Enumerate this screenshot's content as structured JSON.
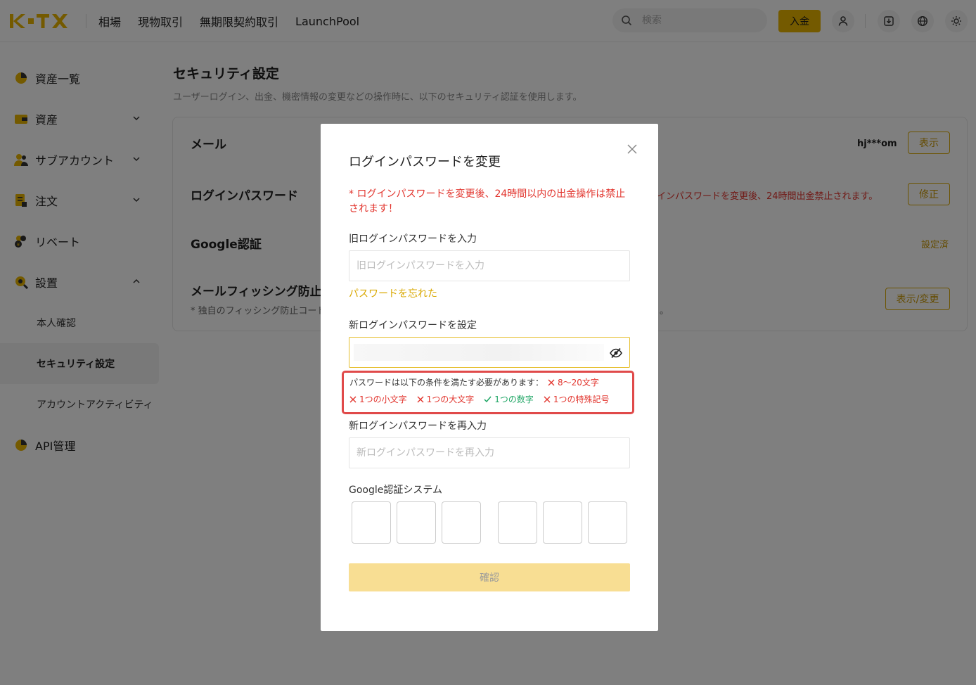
{
  "brand": {
    "logo_text": "KTX",
    "accent": "#e9b400"
  },
  "nav": {
    "items": [
      "相場",
      "現物取引",
      "無期限契約取引",
      "LaunchPool"
    ],
    "search_placeholder": "検索",
    "deposit_label": "入金"
  },
  "sidebar": {
    "items": [
      {
        "label": "資産一覧",
        "icon": "pie-chart-icon"
      },
      {
        "label": "資産",
        "icon": "wallet-icon"
      },
      {
        "label": "サブアカウント",
        "icon": "users-icon"
      },
      {
        "label": "注文",
        "icon": "document-icon"
      },
      {
        "label": "リベート",
        "icon": "rebate-icon"
      },
      {
        "label": "設置",
        "icon": "settings-search-icon"
      }
    ],
    "sub_items": [
      "本人確認",
      "セキュリティ設定",
      "アカウントアクティビティ"
    ],
    "api_label": "API管理"
  },
  "main": {
    "title": "セキュリティ設定",
    "description": "ユーザーログイン、出金、機密情報の変更などの操作時に、以下のセキュリティ認証を使用します。",
    "rows": {
      "email": {
        "title": "メール",
        "value": "hj***om",
        "button": "表示"
      },
      "password": {
        "title": "ログインパスワード",
        "note": "インパスワードを変更後、24時間出金禁止されます。",
        "button": "修正"
      },
      "google": {
        "title": "Google認証",
        "status": "設定済"
      },
      "phishing": {
        "title": "メールフィッシング防止",
        "note": "* 独自のフィッシング防止コード",
        "note_tail": "。",
        "button": "表示/変更"
      }
    }
  },
  "modal": {
    "title": "ログインパスワードを変更",
    "warning": "* ログインパスワードを変更後、24時間以内の出金操作は禁止されます！",
    "old_label": "旧ログインパスワードを入力",
    "old_placeholder": "旧ログインパスワードを入力",
    "forgot": "パスワードを忘れた",
    "new_label": "新ログインパスワードを設定",
    "requirements_intro": "パスワードは以下の条件を満たす必要があります：",
    "requirements": [
      {
        "text": "8～20文字",
        "ok": false
      },
      {
        "text": "1つの小文字",
        "ok": false
      },
      {
        "text": "1つの大文字",
        "ok": false
      },
      {
        "text": "1つの数字",
        "ok": true
      },
      {
        "text": "1つの特殊記号",
        "ok": false
      }
    ],
    "confirm_label": "新ログインパスワードを再入力",
    "confirm_placeholder": "新ログインパスワードを再入力",
    "google_label": "Google認証システム",
    "submit": "確認"
  }
}
